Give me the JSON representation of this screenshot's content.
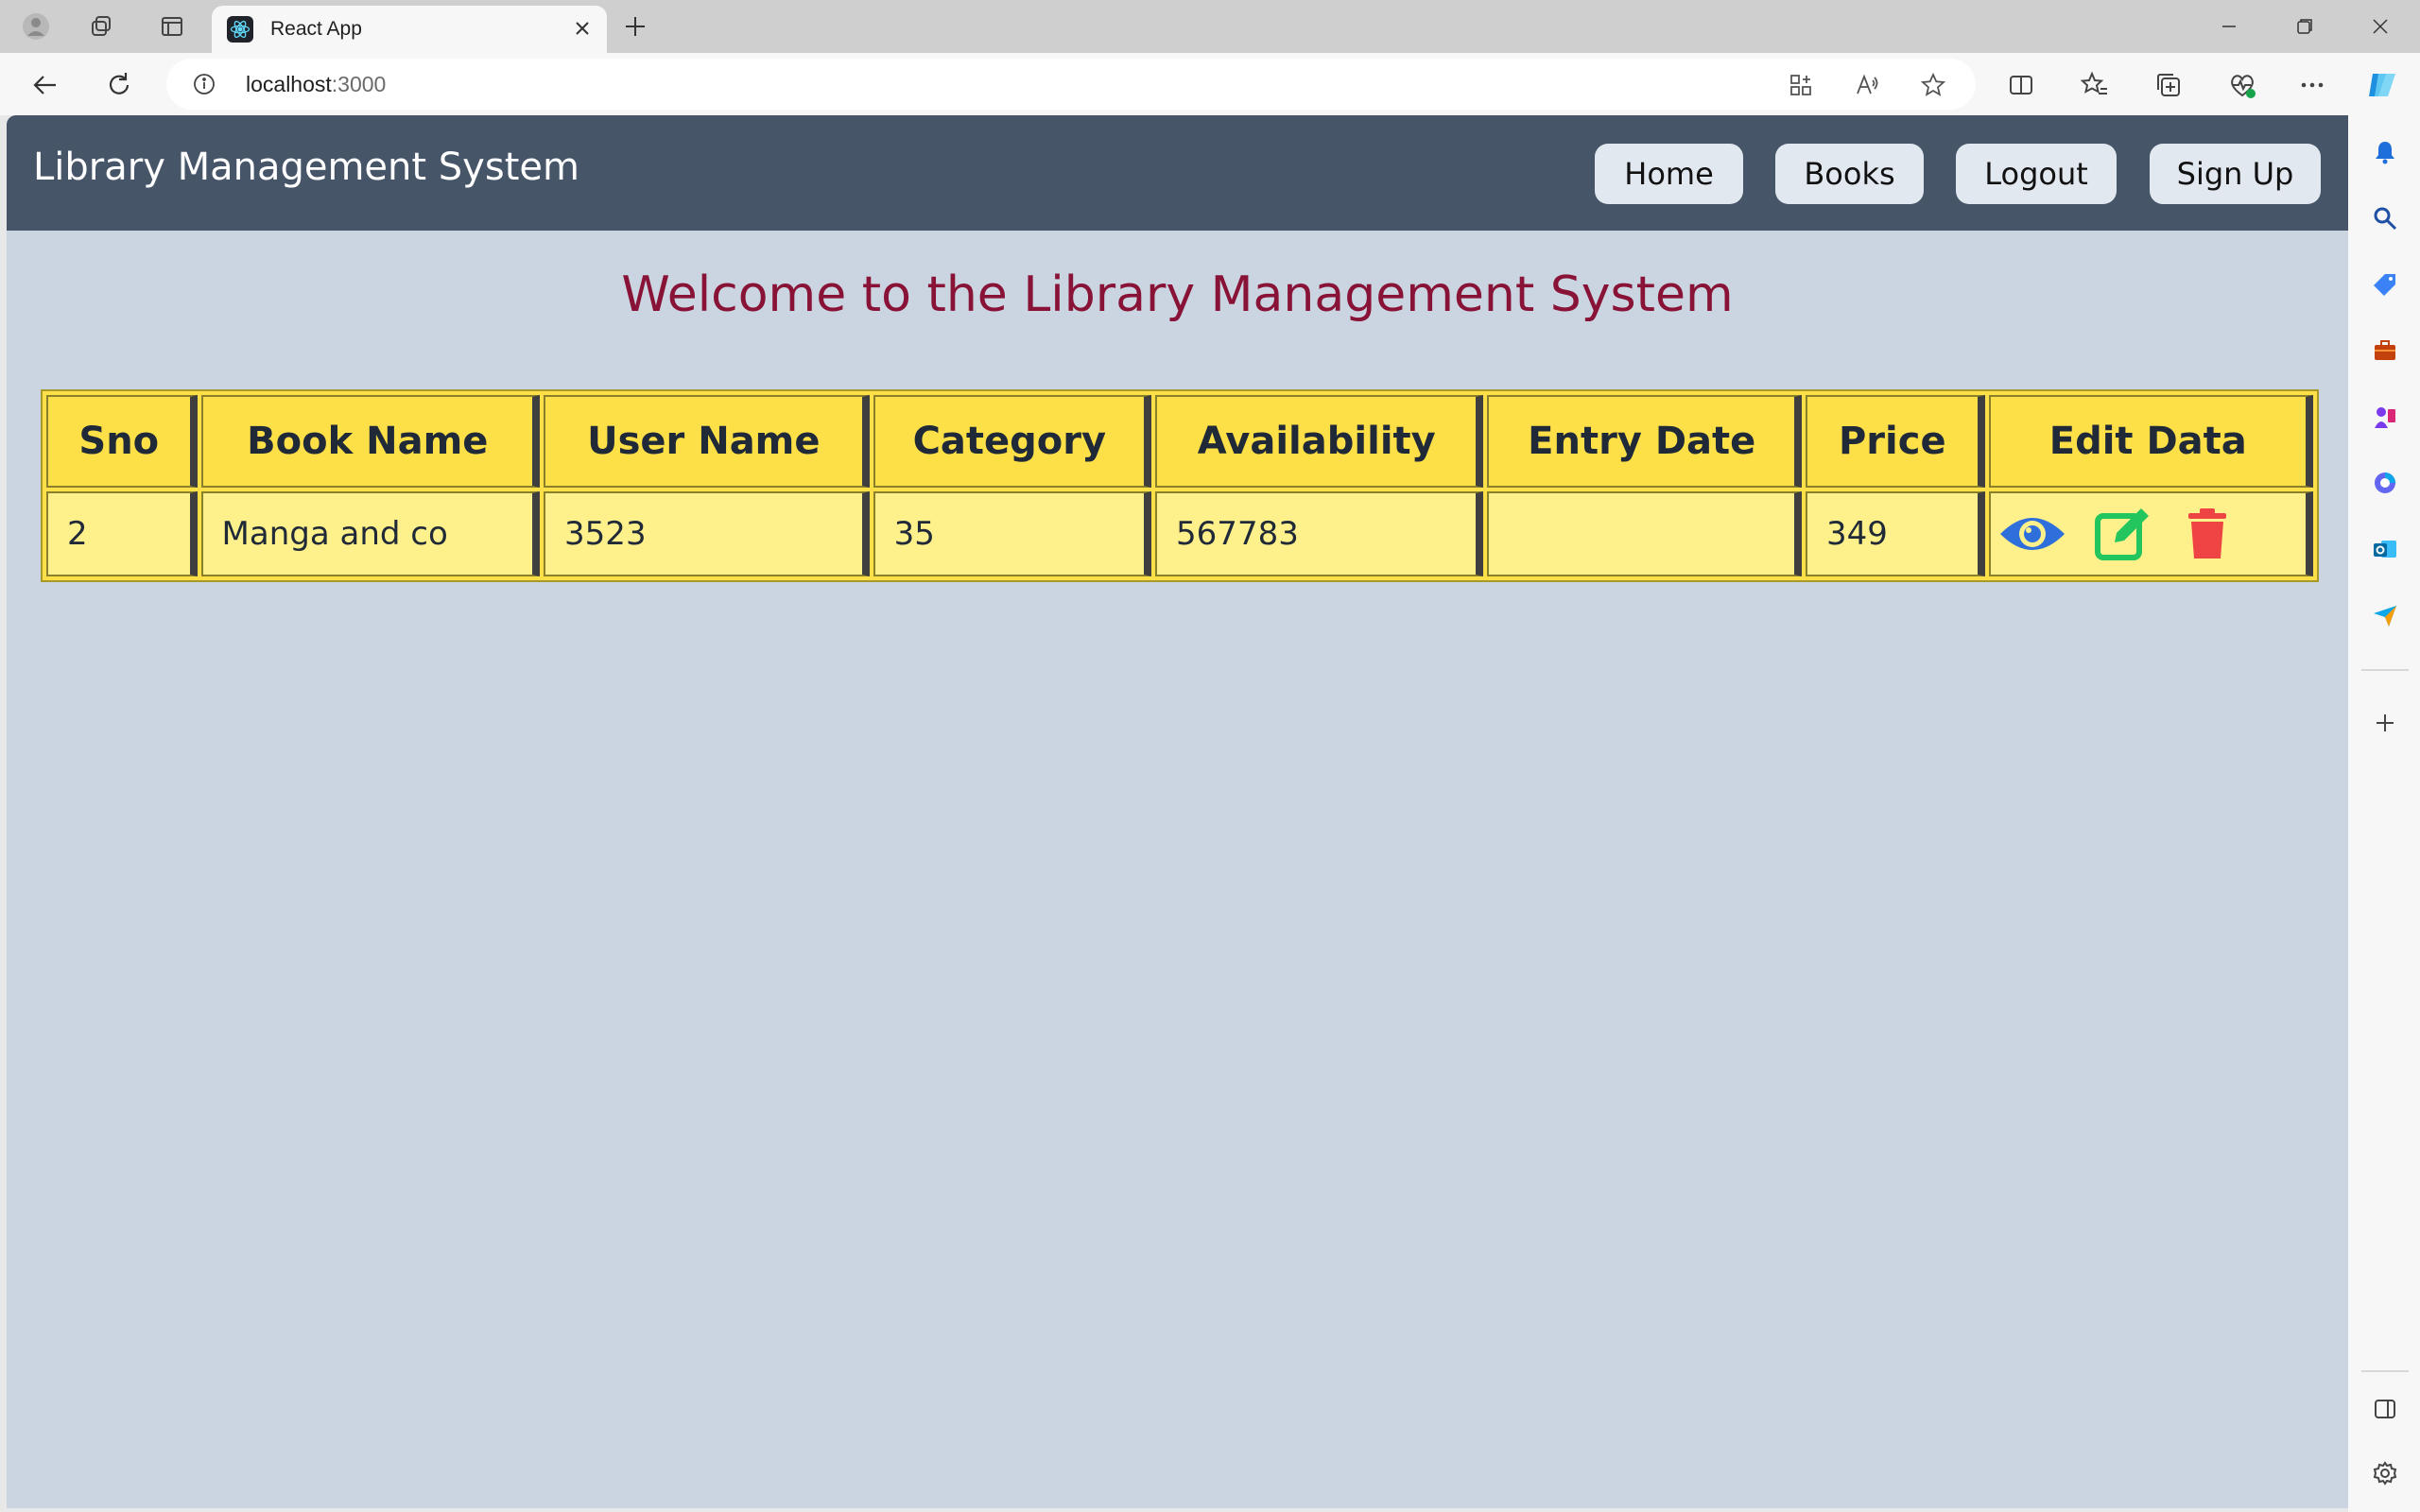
{
  "browser": {
    "tab_title": "React App",
    "url_host": "localhost",
    "url_port": ":3000"
  },
  "navbar": {
    "brand": "Library Management System",
    "links": [
      "Home",
      "Books",
      "Logout",
      "Sign Up"
    ]
  },
  "page": {
    "heading": "Welcome to the Library Management System"
  },
  "table": {
    "headers": [
      "Sno",
      "Book Name",
      "User Name",
      "Category",
      "Availability",
      "Entry Date",
      "Price",
      "Edit Data"
    ],
    "rows": [
      {
        "sno": "2",
        "book_name": "Manga and co",
        "user_name": "3523",
        "category": "35",
        "availability": "567783",
        "entry_date": "",
        "price": "349"
      }
    ],
    "actions": [
      "view-icon",
      "edit-icon",
      "delete-icon"
    ]
  },
  "colors": {
    "navbar": "#475569",
    "page_bg": "#cbd5e1",
    "heading": "#881337",
    "header_cell": "#fde047",
    "body_cell": "#fef08a",
    "view": "#2f6fdb",
    "edit": "#22c55e",
    "delete": "#ef4444"
  }
}
